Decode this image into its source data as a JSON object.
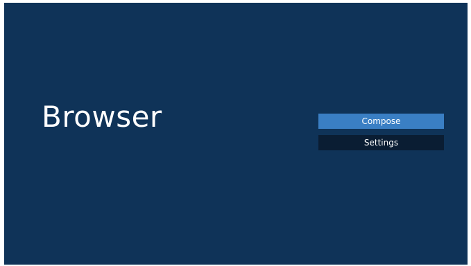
{
  "app": {
    "title": "Browser"
  },
  "menu": {
    "items": [
      {
        "label": "Compose",
        "state": "focused"
      },
      {
        "label": "Settings",
        "state": "normal"
      }
    ]
  },
  "colors": {
    "background": "#0f3358",
    "focused_item": "#3a7fc4",
    "normal_item": "#0a1d33",
    "text": "#ffffff"
  }
}
